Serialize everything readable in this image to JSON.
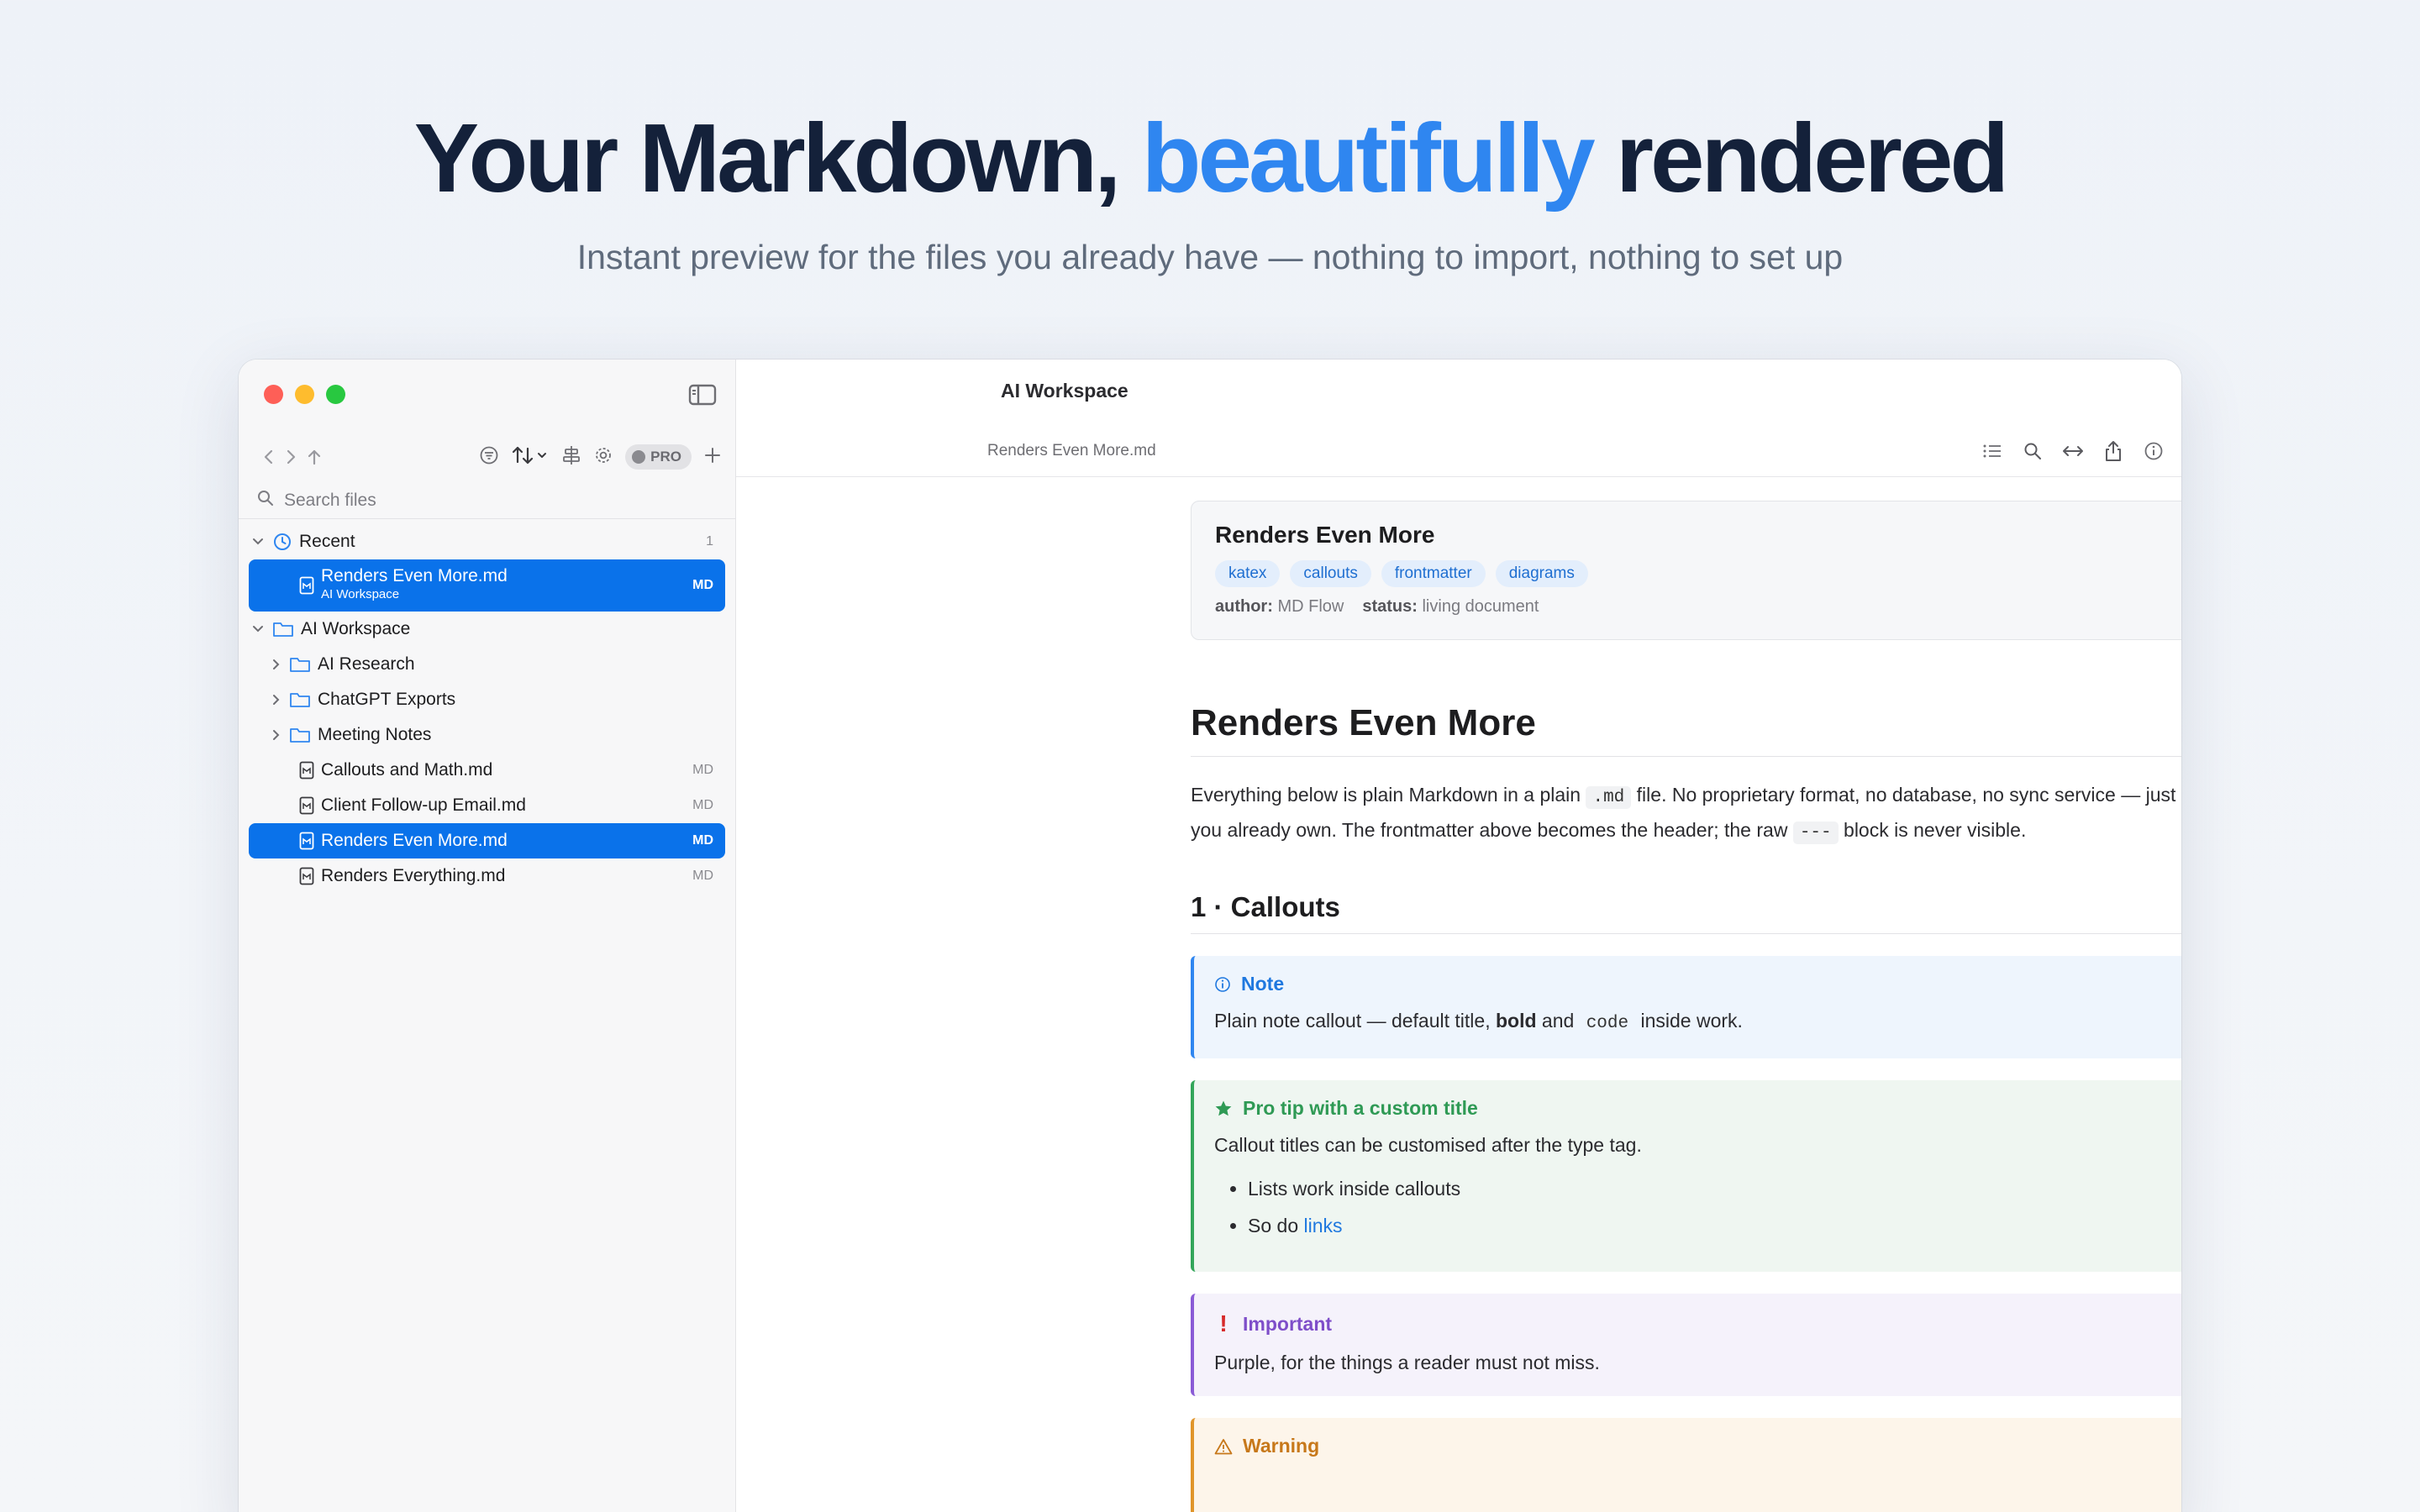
{
  "hero": {
    "title_pre": "Your Markdown, ",
    "title_accent": "beautifully",
    "title_post": " rendered",
    "subtitle": "Instant preview for the files you already have — nothing to import, nothing to set up"
  },
  "sidebar": {
    "pro_label": "PRO",
    "search_placeholder": "Search files",
    "recent": {
      "label": "Recent",
      "count": "1"
    },
    "recent_item": {
      "name": "Renders Even More.md",
      "folder": "AI Workspace",
      "tag": "MD"
    },
    "workspace": {
      "label": "AI Workspace"
    },
    "folders": [
      "AI Research",
      "ChatGPT Exports",
      "Meeting Notes"
    ],
    "files": [
      {
        "name": "Callouts and Math.md",
        "tag": "MD"
      },
      {
        "name": "Client Follow-up Email.md",
        "tag": "MD"
      },
      {
        "name": "Renders Even More.md",
        "tag": "MD"
      },
      {
        "name": "Renders Everything.md",
        "tag": "MD"
      }
    ]
  },
  "main": {
    "window_title": "AI Workspace",
    "breadcrumb": "Renders Even More.md"
  },
  "doc": {
    "front": {
      "title": "Renders Even More",
      "tags": [
        "katex",
        "callouts",
        "frontmatter",
        "diagrams"
      ],
      "author_key": "author:",
      "author_val": "MD Flow",
      "status_key": "status:",
      "status_val": "living document"
    },
    "h1": "Renders Even More",
    "p1_a": "Everything below is plain Markdown in a plain ",
    "p1_code": ".md",
    "p1_b": " file. No proprietary format, no database, no sync service — just text you already own. The frontmatter above becomes the header; the raw ",
    "p1_code2": "---",
    "p1_c": " block is never visible.",
    "h2": "1 · Callouts",
    "note": {
      "title": "Note",
      "b1": "Plain note callout — default title, ",
      "bold": "bold",
      "b2": " and ",
      "code": "code",
      "b3": " inside work."
    },
    "tip": {
      "title": "Pro tip with a custom title",
      "body": "Callout titles can be customised after the type tag.",
      "li1": "Lists work inside callouts",
      "li2_a": "So do ",
      "li2_link": "links"
    },
    "important": {
      "title": "Important",
      "body": "Purple, for the things a reader must not miss."
    },
    "warning": {
      "title": "Warning"
    }
  }
}
